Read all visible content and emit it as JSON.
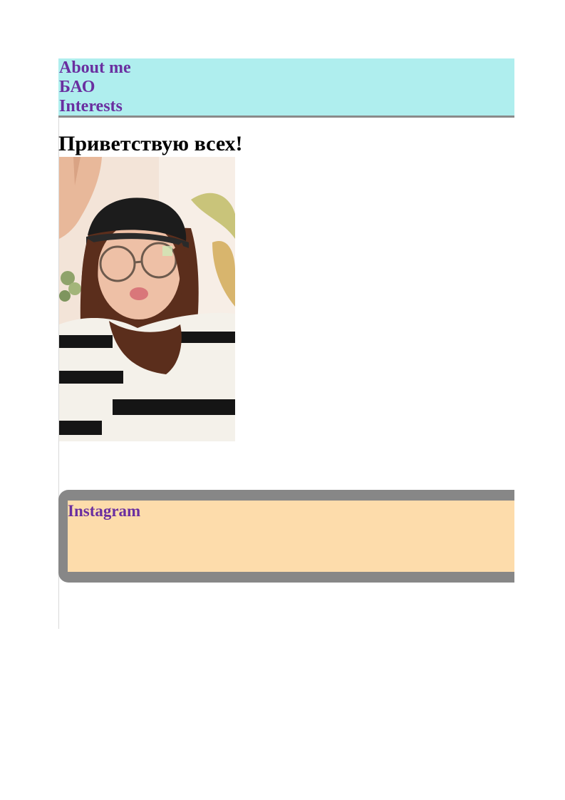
{
  "nav": {
    "items": [
      {
        "label": "About me"
      },
      {
        "label": "БАО"
      },
      {
        "label": "Interests"
      }
    ]
  },
  "main": {
    "greeting": "Приветствую всех!",
    "photo_alt": "Portrait photo: girl in black cap, round glasses and striped sweater"
  },
  "social": {
    "instagram_label": "Instagram"
  },
  "colors": {
    "nav_background": "#afeeee",
    "link_color": "#6a2fa0",
    "social_frame": "#878787",
    "social_background": "#fddcab"
  }
}
